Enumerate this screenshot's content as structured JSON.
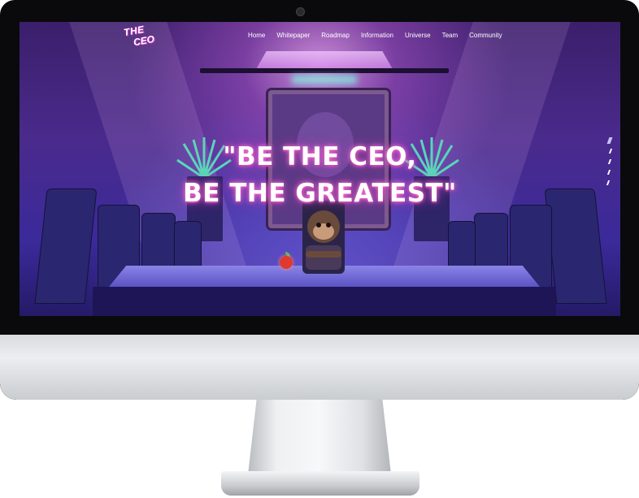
{
  "site": {
    "logo": {
      "line1": "THE",
      "line2": "CEO"
    },
    "nav": {
      "items": [
        {
          "label": "Home"
        },
        {
          "label": "Whitepaper"
        },
        {
          "label": "Roadmap"
        },
        {
          "label": "Information"
        },
        {
          "label": "Universe"
        },
        {
          "label": "Team"
        },
        {
          "label": "Community"
        }
      ]
    },
    "hero": {
      "line1": "\"BE THE CEO,",
      "line2": "BE THE GREATEST\""
    },
    "slides": {
      "count": 5,
      "active_index": 0
    }
  },
  "colors": {
    "accent_pink": "#d43bb6",
    "background_purple": "#4a2a8c",
    "monitor_bezel": "#0a0a0c"
  }
}
